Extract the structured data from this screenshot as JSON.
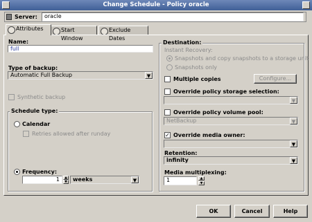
{
  "window": {
    "title": "Change Schedule - Policy oracle"
  },
  "server": {
    "label": "Server:",
    "value": "oracle"
  },
  "tabs": [
    "Attributes",
    "Start Window",
    "Exclude Dates"
  ],
  "left": {
    "name_label": "Name:",
    "name_value": "full",
    "type_label": "Type of backup:",
    "type_value": "Automatic Full Backup",
    "synthetic_label": "Synthetic backup",
    "schedule_type_label": "Schedule type:",
    "calendar_label": "Calendar",
    "retries_label": "Retries allowed after runday",
    "frequency_label": "Frequency:",
    "frequency_value": "1",
    "frequency_unit": "weeks"
  },
  "right": {
    "destination_label": "Destination:",
    "instant_recovery_label": "Instant Recovery:",
    "snap_copy_label": "Snapshots and copy snapshots to a storage unit",
    "snap_only_label": "Snapshots only",
    "multiple_copies_label": "Multiple copies",
    "configure_label": "Configure...",
    "override_storage_label": "Override policy storage selection:",
    "override_volume_label": "Override policy volume pool:",
    "volume_pool_value": "NetBackup",
    "override_media_label": "Override media owner:",
    "retention_label": "Retention:",
    "retention_value": "infinity",
    "multiplexing_label": "Media multiplexing:",
    "multiplexing_value": "1"
  },
  "buttons": {
    "ok": "OK",
    "cancel": "Cancel",
    "help": "Help"
  },
  "icons": {
    "server": "server-icon",
    "tab": "tab-icon",
    "dropdown": "chevron-down-icon",
    "spin_up": "chevron-up-icon",
    "spin_down": "chevron-down-icon"
  },
  "colors": {
    "titlebar": "#4a679e",
    "window_bg": "#d4d0c8"
  }
}
